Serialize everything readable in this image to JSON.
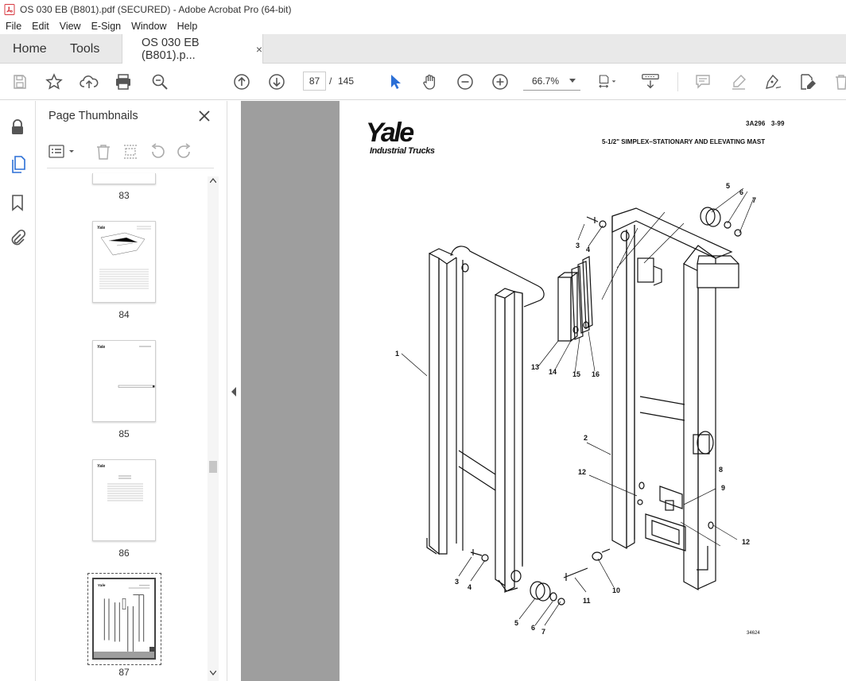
{
  "window": {
    "title": "OS 030 EB (B801).pdf (SECURED) - Adobe Acrobat Pro (64-bit)"
  },
  "menu": [
    "File",
    "Edit",
    "View",
    "E-Sign",
    "Window",
    "Help"
  ],
  "tabs": {
    "home": "Home",
    "tools": "Tools",
    "document": "OS 030 EB (B801).p...",
    "close": "×"
  },
  "toolbar": {
    "current_page": "87",
    "page_separator": "/",
    "total_pages": "145",
    "zoom": "66.7%"
  },
  "panel": {
    "title": "Page Thumbnails",
    "close": "✕"
  },
  "thumbnails": [
    {
      "label": "83"
    },
    {
      "label": "84"
    },
    {
      "label": "85"
    },
    {
      "label": "86"
    },
    {
      "label": "87",
      "selected": true
    }
  ],
  "document": {
    "brand": "Yale",
    "brand_sub": "Industrial Trucks",
    "doc_code": "3A296",
    "doc_date": "3-99",
    "heading": "5-1/2\" SIMPLEX–STATIONARY AND ELEVATING MAST",
    "figure_number": "34624",
    "callouts": [
      "1",
      "2",
      "3",
      "4",
      "5",
      "6",
      "7",
      "8",
      "9",
      "10",
      "11",
      "12",
      "13",
      "14",
      "15",
      "16"
    ]
  },
  "colors": {
    "accent": "#2b6fd6",
    "tab_bg": "#e9e9e9",
    "doc_bg": "#9e9e9e",
    "pdf_red": "#d7373f"
  }
}
